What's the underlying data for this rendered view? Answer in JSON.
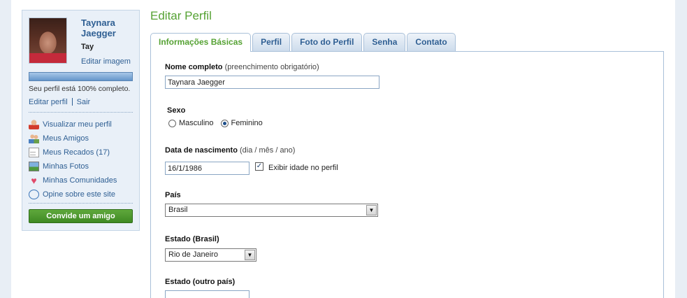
{
  "sidebar": {
    "user_name": "Taynara Jaegger",
    "nickname": "Tay",
    "edit_image": "Editar imagem",
    "profile_progress": 1.0,
    "progress_text": "Seu perfil está 100% completo.",
    "edit_profile": "Editar perfil",
    "logout": "Sair",
    "menu": [
      {
        "label": "Visualizar meu perfil",
        "icon": "person-icon"
      },
      {
        "label": "Meus Amigos",
        "icon": "friends-icon"
      },
      {
        "label": "Meus Recados (17)",
        "icon": "document-icon"
      },
      {
        "label": "Minhas Fotos",
        "icon": "photo-icon"
      },
      {
        "label": "Minhas Comunidades",
        "icon": "heart-icon"
      },
      {
        "label": "Opine sobre este site",
        "icon": "speech-bubble-icon"
      }
    ],
    "invite_button": "Convide um amigo"
  },
  "main": {
    "title": "Editar Perfil",
    "tabs": [
      {
        "label": "Informações Básicas",
        "active": true
      },
      {
        "label": "Perfil",
        "active": false
      },
      {
        "label": "Foto do Perfil",
        "active": false
      },
      {
        "label": "Senha",
        "active": false
      },
      {
        "label": "Contato",
        "active": false
      }
    ]
  },
  "form": {
    "full_name_label": "Nome completo",
    "full_name_hint": "(preenchimento obrigatório)",
    "full_name_value": "Taynara Jaegger",
    "sex_label": "Sexo",
    "sex_options": [
      "Masculino",
      "Feminino"
    ],
    "sex_selected": "Feminino",
    "birth_label": "Data de nascimento",
    "birth_hint": "(dia / mês / ano)",
    "birth_value": "16/1/1986",
    "show_age_label": "Exibir idade no perfil",
    "show_age_checked": true,
    "country_label": "País",
    "country_value": "Brasil",
    "state_label": "Estado (Brasil)",
    "state_value": "Rio de Janeiro",
    "other_state_label": "Estado (outro país)",
    "other_state_value": ""
  },
  "colors": {
    "accent_green": "#56a234",
    "link_blue": "#2f5f93",
    "button_green": "#3f8a23"
  }
}
